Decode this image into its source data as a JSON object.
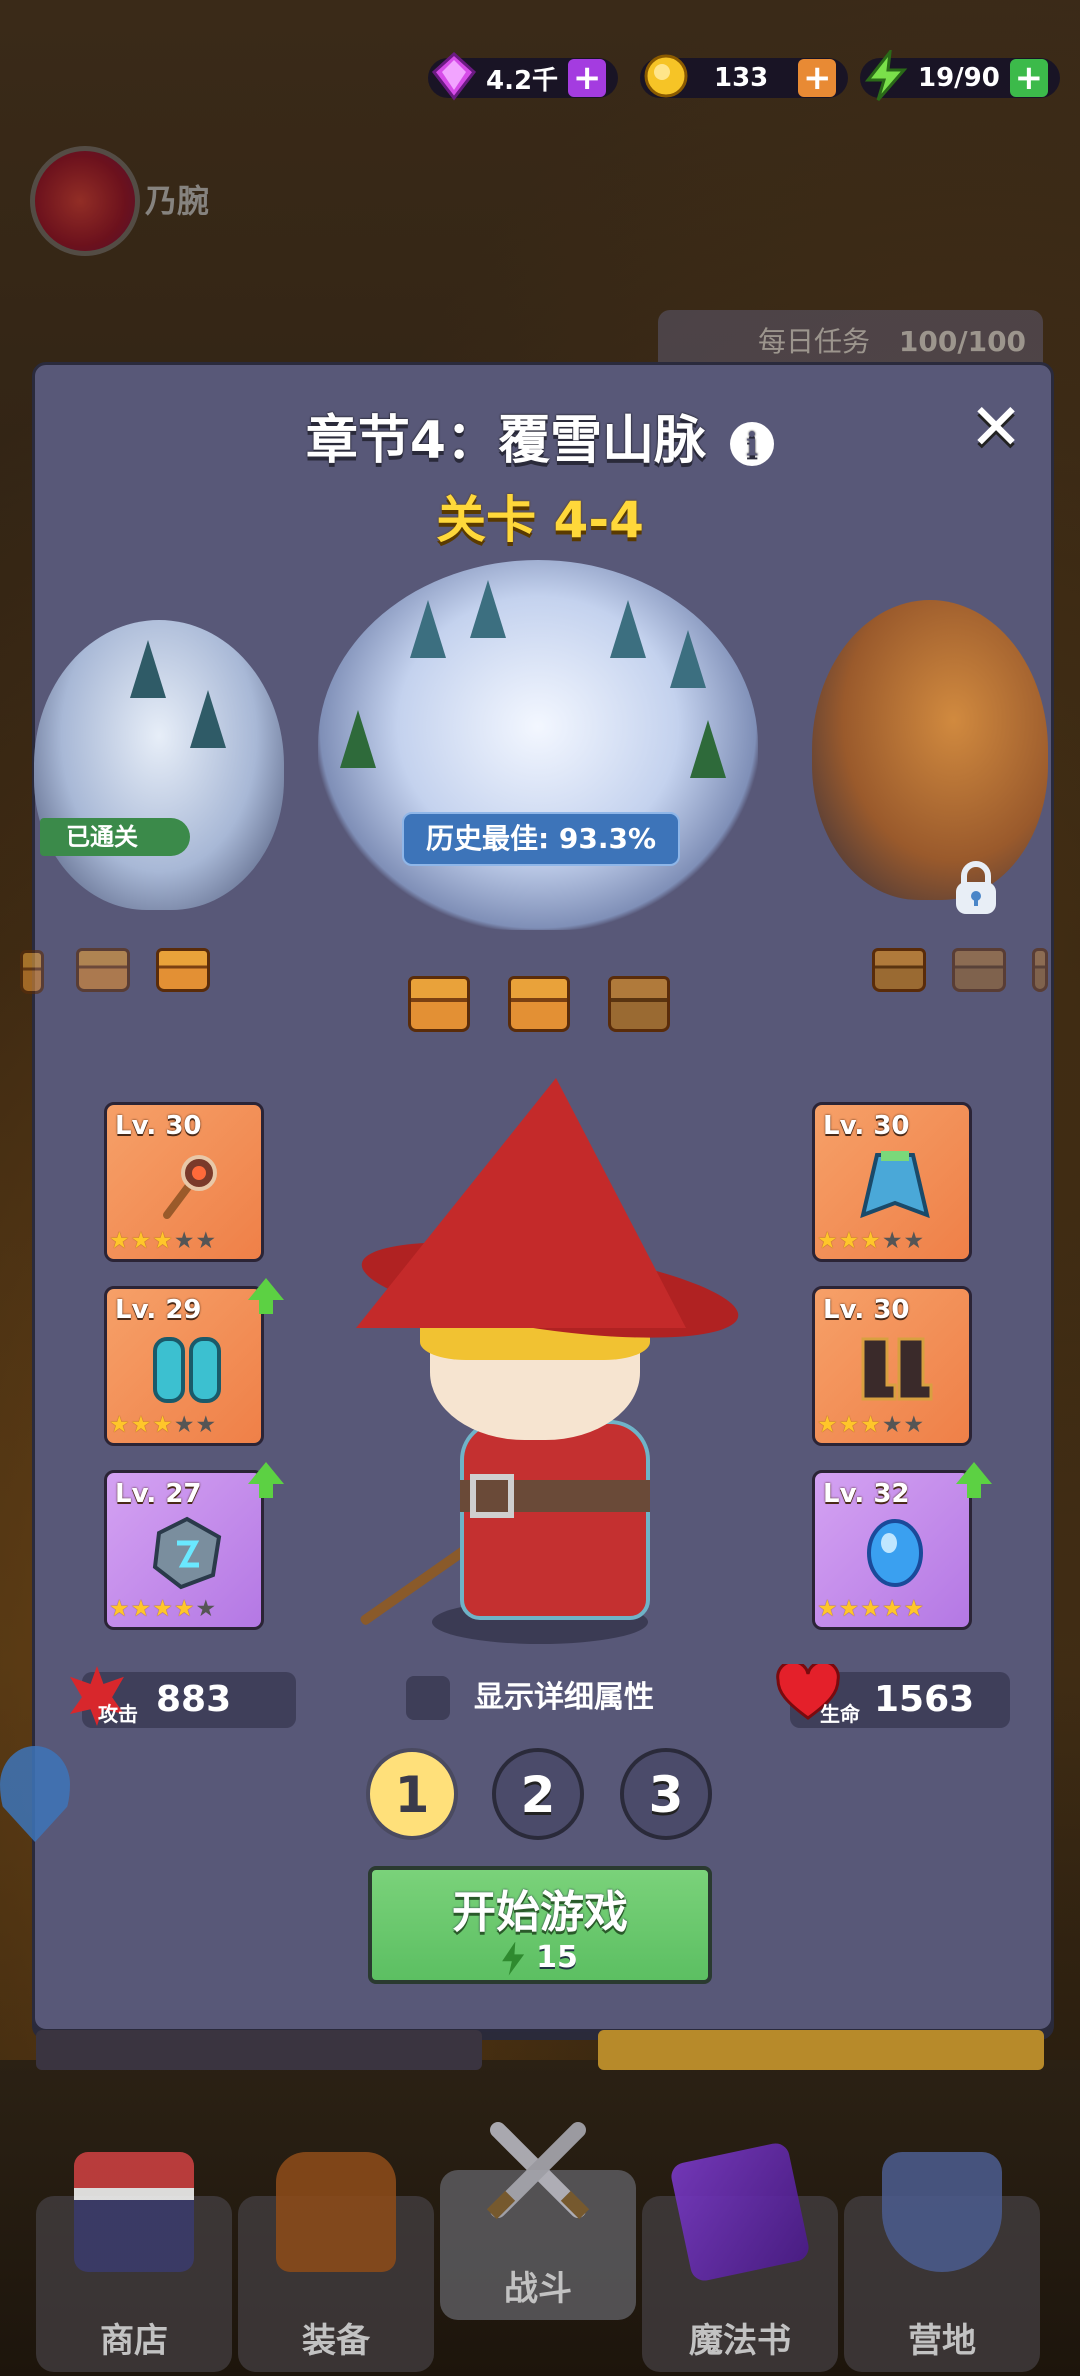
{
  "currency": {
    "gems": "4.2千",
    "coins": "133",
    "energy": "19/90",
    "plus_label": "+"
  },
  "profile": {
    "name": "乃腕"
  },
  "daily_quest": {
    "label": "每日任务",
    "progress": "100/100"
  },
  "chapter": {
    "title": "章节4：覆雪山脉",
    "stage": "关卡 4-4",
    "cleared_label": "已通关",
    "best_record": "历史最佳: 93.3%"
  },
  "equipment": [
    {
      "level": "Lv. 30",
      "stars": 3,
      "max_stars": 5,
      "rarity": "orange",
      "icon": "staff-icon",
      "upgrade": false
    },
    {
      "level": "Lv. 29",
      "stars": 3,
      "max_stars": 5,
      "rarity": "orange",
      "icon": "boots-armor-icon",
      "upgrade": true
    },
    {
      "level": "Lv. 27",
      "stars": 4,
      "max_stars": 5,
      "rarity": "purple",
      "icon": "rune-stone-icon",
      "upgrade": true
    },
    {
      "level": "Lv. 30",
      "stars": 3,
      "max_stars": 5,
      "rarity": "orange",
      "icon": "cape-icon",
      "upgrade": false
    },
    {
      "level": "Lv. 30",
      "stars": 3,
      "max_stars": 5,
      "rarity": "orange",
      "icon": "boots-icon",
      "upgrade": false
    },
    {
      "level": "Lv. 32",
      "stars": 5,
      "max_stars": 5,
      "rarity": "purple",
      "icon": "blue-gem-icon",
      "upgrade": true
    }
  ],
  "stats": {
    "attack_value": "883",
    "attack_label": "攻击",
    "hp_value": "1563",
    "hp_label": "生命",
    "detail_toggle": "显示详细属性"
  },
  "loadouts": [
    "1",
    "2",
    "3"
  ],
  "selected_loadout": "1",
  "start": {
    "label": "开始游戏",
    "cost": "15"
  },
  "nav": [
    {
      "label": "商店",
      "icon": "shop-icon"
    },
    {
      "label": "装备",
      "icon": "backpack-icon"
    },
    {
      "label": "战斗",
      "icon": "crossed-swords-icon"
    },
    {
      "label": "魔法书",
      "icon": "spellbook-icon"
    },
    {
      "label": "营地",
      "icon": "shield-crown-icon"
    }
  ],
  "colors": {
    "modal_bg": "#585878",
    "stage_gold": "#ffd83a",
    "start_green": "#6cc96e",
    "rarity_orange": "#f39060",
    "rarity_purple": "#c48cec"
  }
}
